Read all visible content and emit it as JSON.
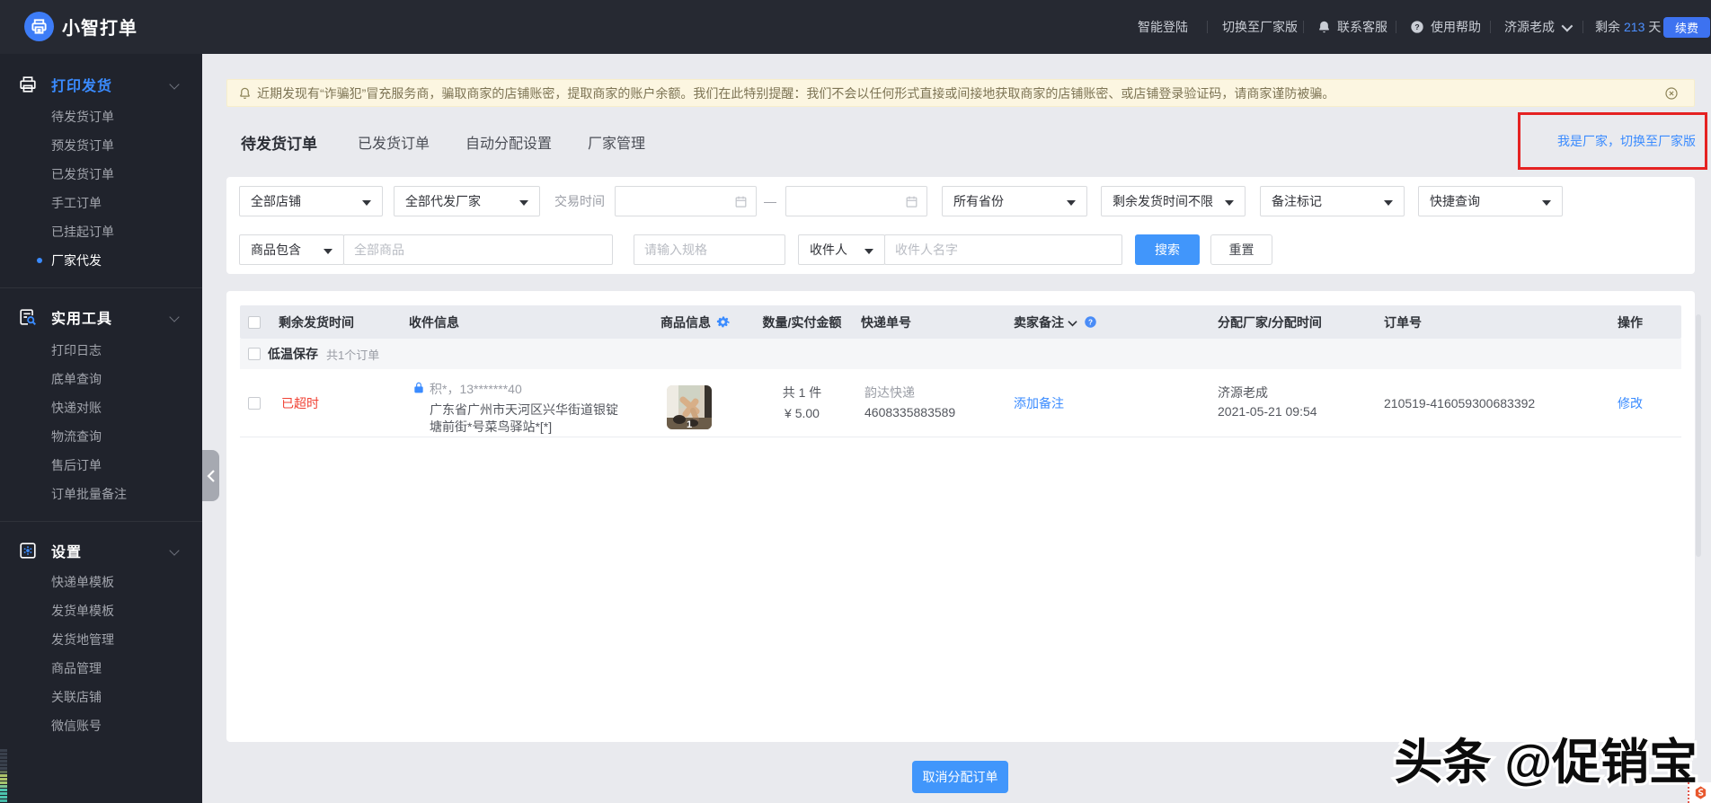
{
  "app": {
    "title": "小智打单"
  },
  "topbar": {
    "smart_login": "智能登陆",
    "switch_factory": "切换至厂家版",
    "contact_service": "联系客服",
    "help": "使用帮助",
    "username": "济源老成",
    "remaining_prefix": "剩余",
    "remaining_days": "213",
    "remaining_suffix": "天",
    "renew": "续费"
  },
  "sidebar": {
    "sections": [
      {
        "title": "打印发货",
        "items": [
          "待发货订单",
          "预发货订单",
          "已发货订单",
          "手工订单",
          "已挂起订单",
          "厂家代发"
        ]
      },
      {
        "title": "实用工具",
        "items": [
          "打印日志",
          "底单查询",
          "快递对账",
          "物流查询",
          "售后订单",
          "订单批量备注"
        ]
      },
      {
        "title": "设置",
        "items": [
          "快递单模板",
          "发货单模板",
          "发货地管理",
          "商品管理",
          "关联店铺",
          "微信账号"
        ]
      }
    ],
    "active_item": "厂家代发"
  },
  "notice": {
    "text": "近期发现有“诈骗犯”冒充服务商，骗取商家的店铺账密，提取商家的账户余额。我们在此特别提醒：我们不会以任何形式直接或间接地获取商家的店铺账密、或店铺登录验证码，请商家谨防被骗。"
  },
  "tabs": [
    {
      "label": "待发货订单"
    },
    {
      "label": "已发货订单"
    },
    {
      "label": "自动分配设置"
    },
    {
      "label": "厂家管理"
    }
  ],
  "factory_banner": {
    "label": "我是厂家，切换至厂家版"
  },
  "filters": {
    "shop": "全部店铺",
    "agent": "全部代发厂家",
    "trade_time_label": "交易时间",
    "date_separator": "—",
    "province": "所有省份",
    "remain_time": "剩余发货时间不限",
    "remark_mark": "备注标记",
    "quick_query": "快捷查询",
    "product_contains": "商品包含",
    "product_placeholder": "全部商品",
    "spec_placeholder": "请输入规格",
    "receiver": "收件人",
    "receiver_placeholder": "收件人名字",
    "search": "搜索",
    "reset": "重置"
  },
  "table": {
    "columns": [
      "剩余发货时间",
      "收件信息",
      "商品信息",
      "数量/实付金额",
      "快递单号",
      "卖家备注",
      "分配厂家/分配时间",
      "订单号",
      "操作"
    ],
    "group": {
      "label": "低温保存",
      "count": "共1个订单"
    },
    "row": {
      "status": "已超时",
      "receiver_masked": "积*，13*******40",
      "address": "广东省广州市天河区兴华街道银锭塘前街*号菜鸟驿站*[*]",
      "qty_badge": "1",
      "quantity": "共 1 件",
      "amount": "¥ 5.00",
      "courier": "韵达快递",
      "tracking_no": "4608335883589",
      "add_remark": "添加备注",
      "factory": "济源老成",
      "assign_time": "2021-05-21 09:54",
      "order_no": "210519-416059300683392",
      "action": "修改"
    }
  },
  "footer": {
    "cancel_assign": "取消分配订单"
  },
  "watermark": {
    "text": "头条 @促销宝"
  }
}
